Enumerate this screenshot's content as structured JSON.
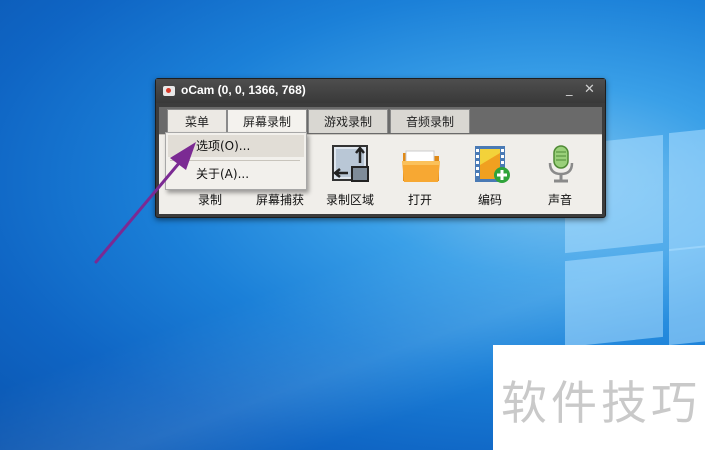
{
  "window": {
    "title": "oCam (0, 0, 1366, 768)",
    "minimize_glyph": "_",
    "close_glyph": "✕"
  },
  "tabs": [
    {
      "label": "菜单"
    },
    {
      "label": "屏幕录制"
    },
    {
      "label": "游戏录制"
    },
    {
      "label": "音频录制"
    }
  ],
  "toolbar": [
    {
      "label": "录制",
      "icon": "record-icon"
    },
    {
      "label": "屏幕捕获",
      "icon": "capture-icon"
    },
    {
      "label": "录制区域",
      "icon": "region-icon"
    },
    {
      "label": "打开",
      "icon": "folder-icon"
    },
    {
      "label": "编码",
      "icon": "codec-icon"
    },
    {
      "label": "声音",
      "icon": "microphone-icon"
    }
  ],
  "menu_dropdown": {
    "items": [
      {
        "label": "选项(O)..."
      },
      {
        "label": "关于(A)..."
      }
    ]
  },
  "watermark": {
    "text": "软件技巧"
  },
  "colors": {
    "annotation_arrow": "#7b2a93",
    "desktop": "#1b80d8",
    "window_frame": "#3c3c3c"
  }
}
